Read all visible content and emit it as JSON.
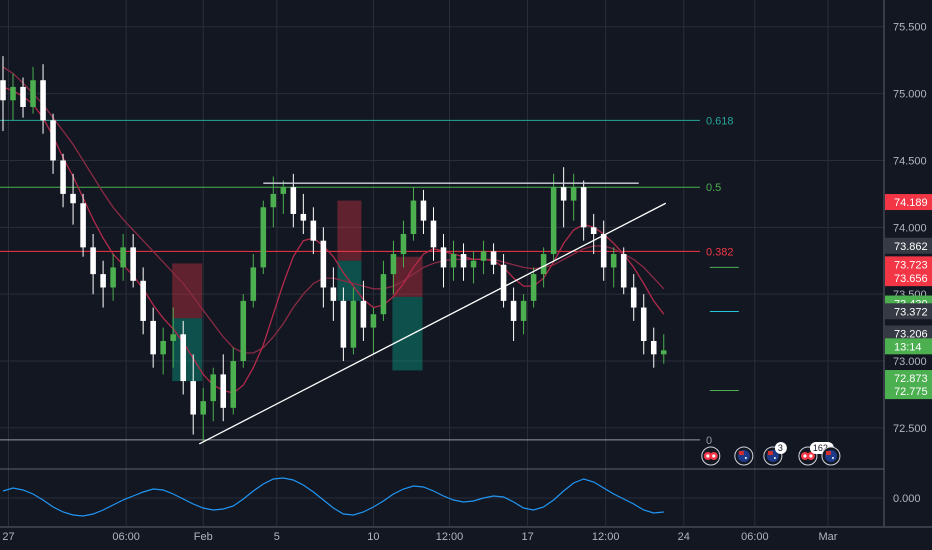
{
  "chart_data": {
    "type": "candlestick",
    "theme": "dark",
    "colors": {
      "background": "#131722",
      "grid": "#2a2e39",
      "up": "#4caf50",
      "down": "#ffffff",
      "ma_fast": "#b22a4a",
      "ma_slow": "#8a2a45",
      "trendline": "#ffffff",
      "oscillator": "#2196f3"
    },
    "y_axis": {
      "range": [
        72.2,
        75.7
      ],
      "ticks": [
        "75.500",
        "75.000",
        "74.500",
        "74.000",
        "73.500",
        "73.000",
        "72.500"
      ]
    },
    "x_axis": {
      "ticks": [
        {
          "label": "27",
          "x": 0.55
        },
        {
          "label": "06:00",
          "x": 12.3
        },
        {
          "label": "Feb",
          "x": 20.0
        },
        {
          "label": "5",
          "x": 27.35
        },
        {
          "label": "10",
          "x": 37.0
        },
        {
          "label": "12:00",
          "x": 44.6
        },
        {
          "label": "17",
          "x": 52.4
        },
        {
          "label": "12:00",
          "x": 60.2
        },
        {
          "label": "24",
          "x": 68.0
        },
        {
          "label": "06:00",
          "x": 75.1
        },
        {
          "label": "Mar",
          "x": 82.4
        }
      ]
    },
    "fibonacci": [
      {
        "level": "0.618",
        "price": 74.8,
        "color": "#26a69a"
      },
      {
        "level": "0.5",
        "price": 74.3,
        "color": "#4caf50"
      },
      {
        "level": "0.382",
        "price": 73.82,
        "color": "#f23645"
      },
      {
        "level": "0",
        "price": 72.41,
        "color": "#9598a1"
      }
    ],
    "price_tags": [
      {
        "text": "74.189",
        "price": 74.189,
        "color": "#f23645"
      },
      {
        "text": "73.862",
        "price": 73.862,
        "color": "#363a45"
      },
      {
        "text": "73.723",
        "price": 73.723,
        "color": "#f23645"
      },
      {
        "text": "73.656",
        "price": 73.62,
        "color": "#f23645"
      },
      {
        "text": "73.430",
        "price": 73.43,
        "color": "#4caf50"
      },
      {
        "text": "73.372",
        "price": 73.372,
        "color": "#363a45"
      },
      {
        "text": "73.206",
        "price": 73.206,
        "color": "#363a45"
      },
      {
        "text": "13:14",
        "price": 73.11,
        "color": "#4caf50"
      },
      {
        "text": "72.873",
        "price": 72.873,
        "color": "#4caf50"
      },
      {
        "text": "72.775",
        "price": 72.775,
        "color": "#4caf50"
      }
    ],
    "ohlc": [
      [
        75.1,
        75.28,
        74.72,
        74.95
      ],
      [
        74.95,
        75.15,
        74.8,
        75.05
      ],
      [
        75.05,
        75.12,
        74.82,
        74.9
      ],
      [
        74.9,
        75.2,
        74.85,
        75.1
      ],
      [
        75.1,
        75.22,
        74.7,
        74.8
      ],
      [
        74.8,
        74.85,
        74.4,
        74.5
      ],
      [
        74.5,
        74.55,
        74.15,
        74.25
      ],
      [
        74.25,
        74.4,
        74.02,
        74.18
      ],
      [
        74.18,
        74.25,
        73.78,
        73.85
      ],
      [
        73.85,
        73.95,
        73.5,
        73.65
      ],
      [
        73.65,
        73.75,
        73.4,
        73.55
      ],
      [
        73.55,
        73.8,
        73.45,
        73.7
      ],
      [
        73.7,
        73.95,
        73.6,
        73.85
      ],
      [
        73.85,
        73.95,
        73.55,
        73.6
      ],
      [
        73.6,
        73.7,
        73.2,
        73.3
      ],
      [
        73.3,
        73.4,
        72.95,
        73.05
      ],
      [
        73.05,
        73.25,
        72.9,
        73.15
      ],
      [
        73.15,
        73.4,
        72.95,
        73.2
      ],
      [
        73.2,
        73.3,
        72.75,
        72.85
      ],
      [
        72.85,
        73.05,
        72.45,
        72.6
      ],
      [
        72.6,
        72.8,
        72.4,
        72.7
      ],
      [
        72.7,
        72.95,
        72.55,
        72.9
      ],
      [
        72.9,
        73.05,
        72.55,
        72.65
      ],
      [
        72.65,
        73.1,
        72.6,
        73.0
      ],
      [
        73.0,
        73.5,
        72.95,
        73.45
      ],
      [
        73.45,
        73.8,
        73.4,
        73.7
      ],
      [
        73.7,
        74.2,
        73.65,
        74.15
      ],
      [
        74.15,
        74.38,
        74.0,
        74.25
      ],
      [
        74.25,
        74.35,
        74.1,
        74.3
      ],
      [
        74.3,
        74.4,
        74.0,
        74.1
      ],
      [
        74.1,
        74.25,
        73.95,
        74.05
      ],
      [
        74.05,
        74.15,
        73.8,
        73.9
      ],
      [
        73.9,
        74.0,
        73.4,
        73.55
      ],
      [
        73.55,
        73.7,
        73.3,
        73.45
      ],
      [
        73.45,
        73.55,
        73.0,
        73.1
      ],
      [
        73.1,
        73.55,
        73.05,
        73.45
      ],
      [
        73.45,
        73.6,
        73.15,
        73.25
      ],
      [
        73.25,
        73.4,
        73.05,
        73.35
      ],
      [
        73.35,
        73.75,
        73.3,
        73.65
      ],
      [
        73.65,
        73.9,
        73.5,
        73.8
      ],
      [
        73.8,
        74.05,
        73.7,
        73.95
      ],
      [
        73.95,
        74.3,
        73.9,
        74.2
      ],
      [
        74.2,
        74.28,
        73.95,
        74.05
      ],
      [
        74.05,
        74.15,
        73.75,
        73.85
      ],
      [
        73.85,
        73.95,
        73.55,
        73.7
      ],
      [
        73.7,
        73.9,
        73.6,
        73.8
      ],
      [
        73.8,
        73.88,
        73.6,
        73.7
      ],
      [
        73.7,
        73.82,
        73.58,
        73.75
      ],
      [
        73.75,
        73.9,
        73.65,
        73.82
      ],
      [
        73.82,
        73.88,
        73.65,
        73.72
      ],
      [
        73.72,
        73.8,
        73.4,
        73.45
      ],
      [
        73.45,
        73.55,
        73.15,
        73.3
      ],
      [
        73.3,
        73.5,
        73.2,
        73.45
      ],
      [
        73.45,
        73.7,
        73.4,
        73.65
      ],
      [
        73.65,
        73.85,
        73.55,
        73.8
      ],
      [
        73.8,
        74.4,
        73.75,
        74.3
      ],
      [
        74.3,
        74.45,
        74.0,
        74.2
      ],
      [
        74.2,
        74.4,
        74.05,
        74.3
      ],
      [
        74.3,
        74.35,
        73.9,
        74.0
      ],
      [
        74.0,
        74.1,
        73.8,
        73.95
      ],
      [
        73.95,
        74.05,
        73.6,
        73.7
      ],
      [
        73.7,
        73.85,
        73.55,
        73.8
      ],
      [
        73.8,
        73.85,
        73.5,
        73.55
      ],
      [
        73.55,
        73.65,
        73.3,
        73.4
      ],
      [
        73.4,
        73.5,
        73.05,
        73.15
      ],
      [
        73.15,
        73.25,
        72.95,
        73.05
      ],
      [
        73.05,
        73.2,
        72.98,
        73.08
      ]
    ],
    "ma_fast": [
      75.05,
      75.02,
      74.98,
      74.92,
      74.82,
      74.68,
      74.52,
      74.38,
      74.22,
      74.06,
      73.92,
      73.8,
      73.72,
      73.64,
      73.54,
      73.42,
      73.32,
      73.24,
      73.14,
      73.02,
      72.9,
      72.82,
      72.78,
      72.76,
      72.82,
      72.95,
      73.12,
      73.35,
      73.58,
      73.78,
      73.9,
      73.92,
      73.86,
      73.78,
      73.66,
      73.56,
      73.46,
      73.4,
      73.42,
      73.48,
      73.58,
      73.7,
      73.8,
      73.84,
      73.82,
      73.8,
      73.78,
      73.76,
      73.76,
      73.75,
      73.7,
      73.62,
      73.56,
      73.56,
      73.62,
      73.74,
      73.88,
      73.98,
      74.02,
      74.0,
      73.95,
      73.88,
      73.8,
      73.7,
      73.58,
      73.45,
      73.35
    ],
    "ma_slow": [
      75.2,
      75.15,
      75.08,
      75.0,
      74.92,
      74.82,
      74.72,
      74.62,
      74.5,
      74.38,
      74.26,
      74.15,
      74.06,
      73.98,
      73.9,
      73.82,
      73.74,
      73.66,
      73.58,
      73.48,
      73.38,
      73.28,
      73.18,
      73.1,
      73.06,
      73.06,
      73.1,
      73.18,
      73.28,
      73.4,
      73.5,
      73.58,
      73.62,
      73.62,
      73.6,
      73.58,
      73.56,
      73.54,
      73.54,
      73.56,
      73.6,
      73.65,
      73.7,
      73.73,
      73.75,
      73.76,
      73.76,
      73.76,
      73.76,
      73.76,
      73.74,
      73.72,
      73.7,
      73.69,
      73.7,
      73.72,
      73.76,
      73.8,
      73.84,
      73.86,
      73.86,
      73.84,
      73.8,
      73.76,
      73.7,
      73.62,
      73.54
    ],
    "trendline": [
      [
        19.6,
        72.38
      ],
      [
        66.2,
        74.18
      ]
    ],
    "resistance": [
      [
        26.0,
        74.33
      ],
      [
        63.5,
        74.33
      ]
    ],
    "position_boxes": [
      {
        "x0": 16.9,
        "x1": 19.9,
        "target": 72.85,
        "entry": 73.32,
        "stop": 73.73
      },
      {
        "x0": 33.4,
        "x1": 35.8,
        "target": 73.45,
        "entry": 73.75,
        "stop": 74.2
      },
      {
        "x0": 38.9,
        "x1": 41.9,
        "target": 72.93,
        "entry": 73.48,
        "stop": 73.78
      }
    ],
    "short_ticks": [
      {
        "x0": 70.6,
        "x1": 73.5,
        "price": 73.7,
        "color": "#4caf50"
      },
      {
        "x0": 70.6,
        "x1": 73.5,
        "price": 73.37,
        "color": "#26c6da"
      },
      {
        "x0": 70.6,
        "x1": 73.5,
        "price": 72.78,
        "color": "#4caf50"
      }
    ],
    "events": [
      {
        "x": 70.7,
        "count": "",
        "kind": "dual"
      },
      {
        "x": 74.0,
        "count": "",
        "kind": "flag"
      },
      {
        "x": 76.9,
        "count": "3",
        "kind": "flag"
      },
      {
        "x": 80.4,
        "count": "162",
        "kind": "dual"
      },
      {
        "x": 82.7,
        "count": "",
        "kind": "flag"
      }
    ],
    "oscillator": {
      "label": "0.000",
      "values": [
        0.35,
        0.5,
        0.4,
        0.2,
        -0.1,
        -0.45,
        -0.7,
        -0.85,
        -0.9,
        -0.8,
        -0.6,
        -0.35,
        -0.1,
        0.1,
        0.3,
        0.45,
        0.4,
        0.2,
        -0.05,
        -0.3,
        -0.5,
        -0.6,
        -0.55,
        -0.4,
        -0.05,
        0.35,
        0.7,
        0.95,
        1.0,
        0.9,
        0.65,
        0.3,
        -0.1,
        -0.5,
        -0.8,
        -0.85,
        -0.7,
        -0.45,
        -0.15,
        0.2,
        0.45,
        0.6,
        0.55,
        0.35,
        0.1,
        -0.1,
        -0.2,
        -0.15,
        0.0,
        0.1,
        0.05,
        -0.2,
        -0.5,
        -0.6,
        -0.45,
        -0.1,
        0.35,
        0.75,
        0.95,
        0.8,
        0.5,
        0.2,
        -0.05,
        -0.3,
        -0.6,
        -0.75,
        -0.7
      ]
    }
  }
}
